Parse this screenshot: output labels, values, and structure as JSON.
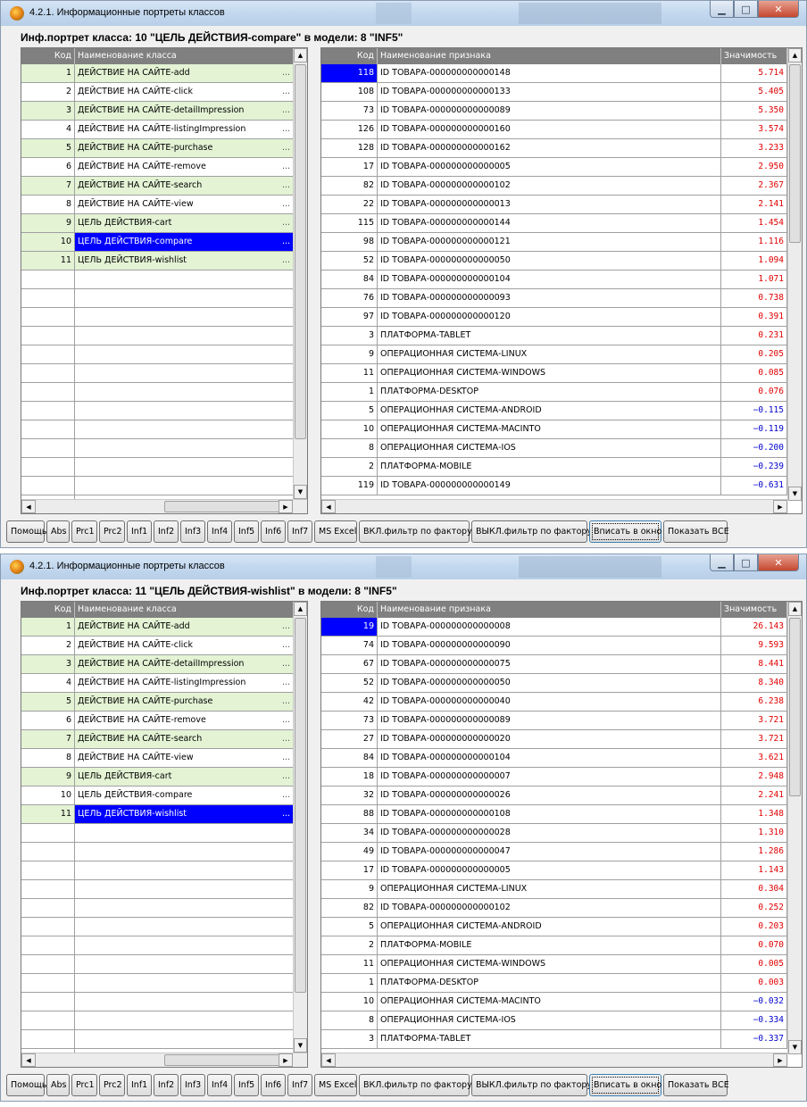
{
  "windows": [
    {
      "title": "4.2.1. Информационные портреты классов",
      "heading": "Инф.портрет класса: 10 \"ЦЕЛЬ ДЕЙСТВИЯ-compare\" в модели: 8 \"INF5\"",
      "left_headers": {
        "code": "Код",
        "name": "Наименование класса"
      },
      "right_headers": {
        "code": "Код",
        "name": "Наименование признака",
        "value": "Значимость"
      },
      "classes": [
        {
          "code": "1",
          "name": "ДЕЙСТВИЕ НА САЙТЕ-add"
        },
        {
          "code": "2",
          "name": "ДЕЙСТВИЕ НА САЙТЕ-click"
        },
        {
          "code": "3",
          "name": "ДЕЙСТВИЕ НА САЙТЕ-detailImpression"
        },
        {
          "code": "4",
          "name": "ДЕЙСТВИЕ НА САЙТЕ-listingImpression"
        },
        {
          "code": "5",
          "name": "ДЕЙСТВИЕ НА САЙТЕ-purchase"
        },
        {
          "code": "6",
          "name": "ДЕЙСТВИЕ НА САЙТЕ-remove"
        },
        {
          "code": "7",
          "name": "ДЕЙСТВИЕ НА САЙТЕ-search"
        },
        {
          "code": "8",
          "name": "ДЕЙСТВИЕ НА САЙТЕ-view"
        },
        {
          "code": "9",
          "name": "ЦЕЛЬ ДЕЙСТВИЯ-cart"
        },
        {
          "code": "10",
          "name": "ЦЕЛЬ ДЕЙСТВИЯ-compare"
        },
        {
          "code": "11",
          "name": "ЦЕЛЬ ДЕЙСТВИЯ-wishlist"
        }
      ],
      "selected_class": 10,
      "features": [
        {
          "code": "118",
          "name": "ID ТОВАРА-000000000000148",
          "value": "5.714"
        },
        {
          "code": "108",
          "name": "ID ТОВАРА-000000000000133",
          "value": "5.405"
        },
        {
          "code": "73",
          "name": "ID ТОВАРА-000000000000089",
          "value": "5.350"
        },
        {
          "code": "126",
          "name": "ID ТОВАРА-000000000000160",
          "value": "3.574"
        },
        {
          "code": "128",
          "name": "ID ТОВАРА-000000000000162",
          "value": "3.233"
        },
        {
          "code": "17",
          "name": "ID ТОВАРА-000000000000005",
          "value": "2.950"
        },
        {
          "code": "82",
          "name": "ID ТОВАРА-000000000000102",
          "value": "2.367"
        },
        {
          "code": "22",
          "name": "ID ТОВАРА-000000000000013",
          "value": "2.141"
        },
        {
          "code": "115",
          "name": "ID ТОВАРА-000000000000144",
          "value": "1.454"
        },
        {
          "code": "98",
          "name": "ID ТОВАРА-000000000000121",
          "value": "1.116"
        },
        {
          "code": "52",
          "name": "ID ТОВАРА-000000000000050",
          "value": "1.094"
        },
        {
          "code": "84",
          "name": "ID ТОВАРА-000000000000104",
          "value": "1.071"
        },
        {
          "code": "76",
          "name": "ID ТОВАРА-000000000000093",
          "value": "0.738"
        },
        {
          "code": "97",
          "name": "ID ТОВАРА-000000000000120",
          "value": "0.391"
        },
        {
          "code": "3",
          "name": "ПЛАТФОРМА-TABLET",
          "value": "0.231"
        },
        {
          "code": "9",
          "name": "ОПЕРАЦИОННАЯ СИСТЕМА-LINUX",
          "value": "0.205"
        },
        {
          "code": "11",
          "name": "ОПЕРАЦИОННАЯ СИСТЕМА-WINDOWS",
          "value": "0.085"
        },
        {
          "code": "1",
          "name": "ПЛАТФОРМА-DESKTOP",
          "value": "0.076"
        },
        {
          "code": "5",
          "name": "ОПЕРАЦИОННАЯ СИСТЕМА-ANDROID",
          "value": "−0.115"
        },
        {
          "code": "10",
          "name": "ОПЕРАЦИОННАЯ СИСТЕМА-MACINTO",
          "value": "−0.119"
        },
        {
          "code": "8",
          "name": "ОПЕРАЦИОННАЯ СИСТЕМА-IOS",
          "value": "−0.200"
        },
        {
          "code": "2",
          "name": "ПЛАТФОРМА-MOBILE",
          "value": "−0.239"
        },
        {
          "code": "119",
          "name": "ID ТОВАРА-000000000000149",
          "value": "−0.631"
        }
      ],
      "buttons": [
        "Помощь",
        "Abs",
        "Prc1",
        "Prc2",
        "Inf1",
        "Inf2",
        "Inf3",
        "Inf4",
        "Inf5",
        "Inf6",
        "Inf7",
        "MS Excel",
        "ВКЛ.фильтр по фактору",
        "ВЫКЛ.фильтр по фактору",
        "Вписать в окно",
        "Показать ВСЕ"
      ]
    },
    {
      "title": "4.2.1. Информационные портреты классов",
      "heading": "Инф.портрет класса: 11 \"ЦЕЛЬ ДЕЙСТВИЯ-wishlist\" в модели: 8 \"INF5\"",
      "left_headers": {
        "code": "Код",
        "name": "Наименование класса"
      },
      "right_headers": {
        "code": "Код",
        "name": "Наименование признака",
        "value": "Значимость"
      },
      "classes": [
        {
          "code": "1",
          "name": "ДЕЙСТВИЕ НА САЙТЕ-add"
        },
        {
          "code": "2",
          "name": "ДЕЙСТВИЕ НА САЙТЕ-click"
        },
        {
          "code": "3",
          "name": "ДЕЙСТВИЕ НА САЙТЕ-detailImpression"
        },
        {
          "code": "4",
          "name": "ДЕЙСТВИЕ НА САЙТЕ-listingImpression"
        },
        {
          "code": "5",
          "name": "ДЕЙСТВИЕ НА САЙТЕ-purchase"
        },
        {
          "code": "6",
          "name": "ДЕЙСТВИЕ НА САЙТЕ-remove"
        },
        {
          "code": "7",
          "name": "ДЕЙСТВИЕ НА САЙТЕ-search"
        },
        {
          "code": "8",
          "name": "ДЕЙСТВИЕ НА САЙТЕ-view"
        },
        {
          "code": "9",
          "name": "ЦЕЛЬ ДЕЙСТВИЯ-cart"
        },
        {
          "code": "10",
          "name": "ЦЕЛЬ ДЕЙСТВИЯ-compare"
        },
        {
          "code": "11",
          "name": "ЦЕЛЬ ДЕЙСТВИЯ-wishlist"
        }
      ],
      "selected_class": 11,
      "features": [
        {
          "code": "19",
          "name": "ID ТОВАРА-000000000000008",
          "value": "26.143"
        },
        {
          "code": "74",
          "name": "ID ТОВАРА-000000000000090",
          "value": "9.593"
        },
        {
          "code": "67",
          "name": "ID ТОВАРА-000000000000075",
          "value": "8.441"
        },
        {
          "code": "52",
          "name": "ID ТОВАРА-000000000000050",
          "value": "8.340"
        },
        {
          "code": "42",
          "name": "ID ТОВАРА-000000000000040",
          "value": "6.238"
        },
        {
          "code": "73",
          "name": "ID ТОВАРА-000000000000089",
          "value": "3.721"
        },
        {
          "code": "27",
          "name": "ID ТОВАРА-000000000000020",
          "value": "3.721"
        },
        {
          "code": "84",
          "name": "ID ТОВАРА-000000000000104",
          "value": "3.621"
        },
        {
          "code": "18",
          "name": "ID ТОВАРА-000000000000007",
          "value": "2.948"
        },
        {
          "code": "32",
          "name": "ID ТОВАРА-000000000000026",
          "value": "2.241"
        },
        {
          "code": "88",
          "name": "ID ТОВАРА-000000000000108",
          "value": "1.348"
        },
        {
          "code": "34",
          "name": "ID ТОВАРА-000000000000028",
          "value": "1.310"
        },
        {
          "code": "49",
          "name": "ID ТОВАРА-000000000000047",
          "value": "1.286"
        },
        {
          "code": "17",
          "name": "ID ТОВАРА-000000000000005",
          "value": "1.143"
        },
        {
          "code": "9",
          "name": "ОПЕРАЦИОННАЯ СИСТЕМА-LINUX",
          "value": "0.304"
        },
        {
          "code": "82",
          "name": "ID ТОВАРА-000000000000102",
          "value": "0.252"
        },
        {
          "code": "5",
          "name": "ОПЕРАЦИОННАЯ СИСТЕМА-ANDROID",
          "value": "0.203"
        },
        {
          "code": "2",
          "name": "ПЛАТФОРМА-MOBILE",
          "value": "0.070"
        },
        {
          "code": "11",
          "name": "ОПЕРАЦИОННАЯ СИСТЕМА-WINDOWS",
          "value": "0.005"
        },
        {
          "code": "1",
          "name": "ПЛАТФОРМА-DESKTOP",
          "value": "0.003"
        },
        {
          "code": "10",
          "name": "ОПЕРАЦИОННАЯ СИСТЕМА-MACINTO",
          "value": "−0.032"
        },
        {
          "code": "8",
          "name": "ОПЕРАЦИОННАЯ СИСТЕМА-IOS",
          "value": "−0.334"
        },
        {
          "code": "3",
          "name": "ПЛАТФОРМА-TABLET",
          "value": "−0.337"
        }
      ],
      "buttons": [
        "Помощь",
        "Abs",
        "Prc1",
        "Prc2",
        "Inf1",
        "Inf2",
        "Inf3",
        "Inf4",
        "Inf5",
        "Inf6",
        "Inf7",
        "MS Excel",
        "ВКЛ.фильтр по фактору",
        "ВЫКЛ.фильтр по фактору",
        "Вписать в окно",
        "Показать ВСЕ"
      ]
    }
  ],
  "focused_button": "Вписать в окно",
  "icons": {
    "app": "app-icon",
    "minimize": "minimize-icon",
    "maximize": "maximize-icon",
    "close": "close-icon"
  },
  "colors": {
    "header_bg": "#808080",
    "alt_row": "#e3f3d4",
    "selection": "#0000ff",
    "positive": "#e00000",
    "negative": "#0000cc"
  }
}
